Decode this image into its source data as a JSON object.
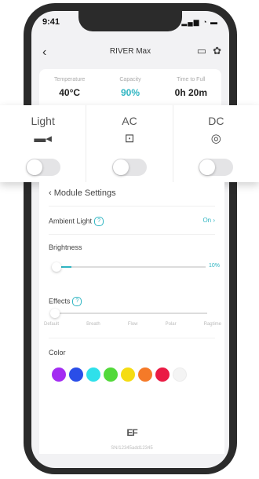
{
  "status_bar": {
    "time": "9:41",
    "icons": "▂▄▆ ◔ ▬"
  },
  "nav": {
    "back_icon": "‹",
    "title": "RIVER Max",
    "icons": [
      "chat-icon",
      "fan-icon"
    ]
  },
  "stats": [
    {
      "label": "Temperature",
      "value": "40°C"
    },
    {
      "label": "Capacity",
      "value": "90%"
    },
    {
      "label": "Time to Full",
      "value": "0h 20m"
    }
  ],
  "outlets": [
    {
      "label": "Light",
      "icon": "flashlight-icon",
      "on": false
    },
    {
      "label": "AC",
      "icon": "ac-plug-icon",
      "on": false
    },
    {
      "label": "DC",
      "icon": "dc-port-icon",
      "on": false
    }
  ],
  "module": {
    "header": "Module Settings",
    "ambient_light": {
      "label": "Ambient Light",
      "value": "On"
    },
    "brightness": {
      "label": "Brightness",
      "value_text": "10%",
      "level": 0.1
    },
    "effects": {
      "label": "Effects",
      "options": [
        "Default",
        "Breath",
        "Flow",
        "Polar",
        "Ragtime"
      ],
      "selected": "Default"
    },
    "color": {
      "label": "Color",
      "swatches": [
        "#a32cf2",
        "#2a4ee8",
        "#2fe0ea",
        "#52d93a",
        "#f5dc12",
        "#f57a28",
        "#ea1a44",
        "#f4f4f4"
      ]
    },
    "footer": {
      "logo_text": "EF",
      "serial": "SN/12345add12345"
    }
  },
  "colors": {
    "accent": "#2fb5c2"
  }
}
